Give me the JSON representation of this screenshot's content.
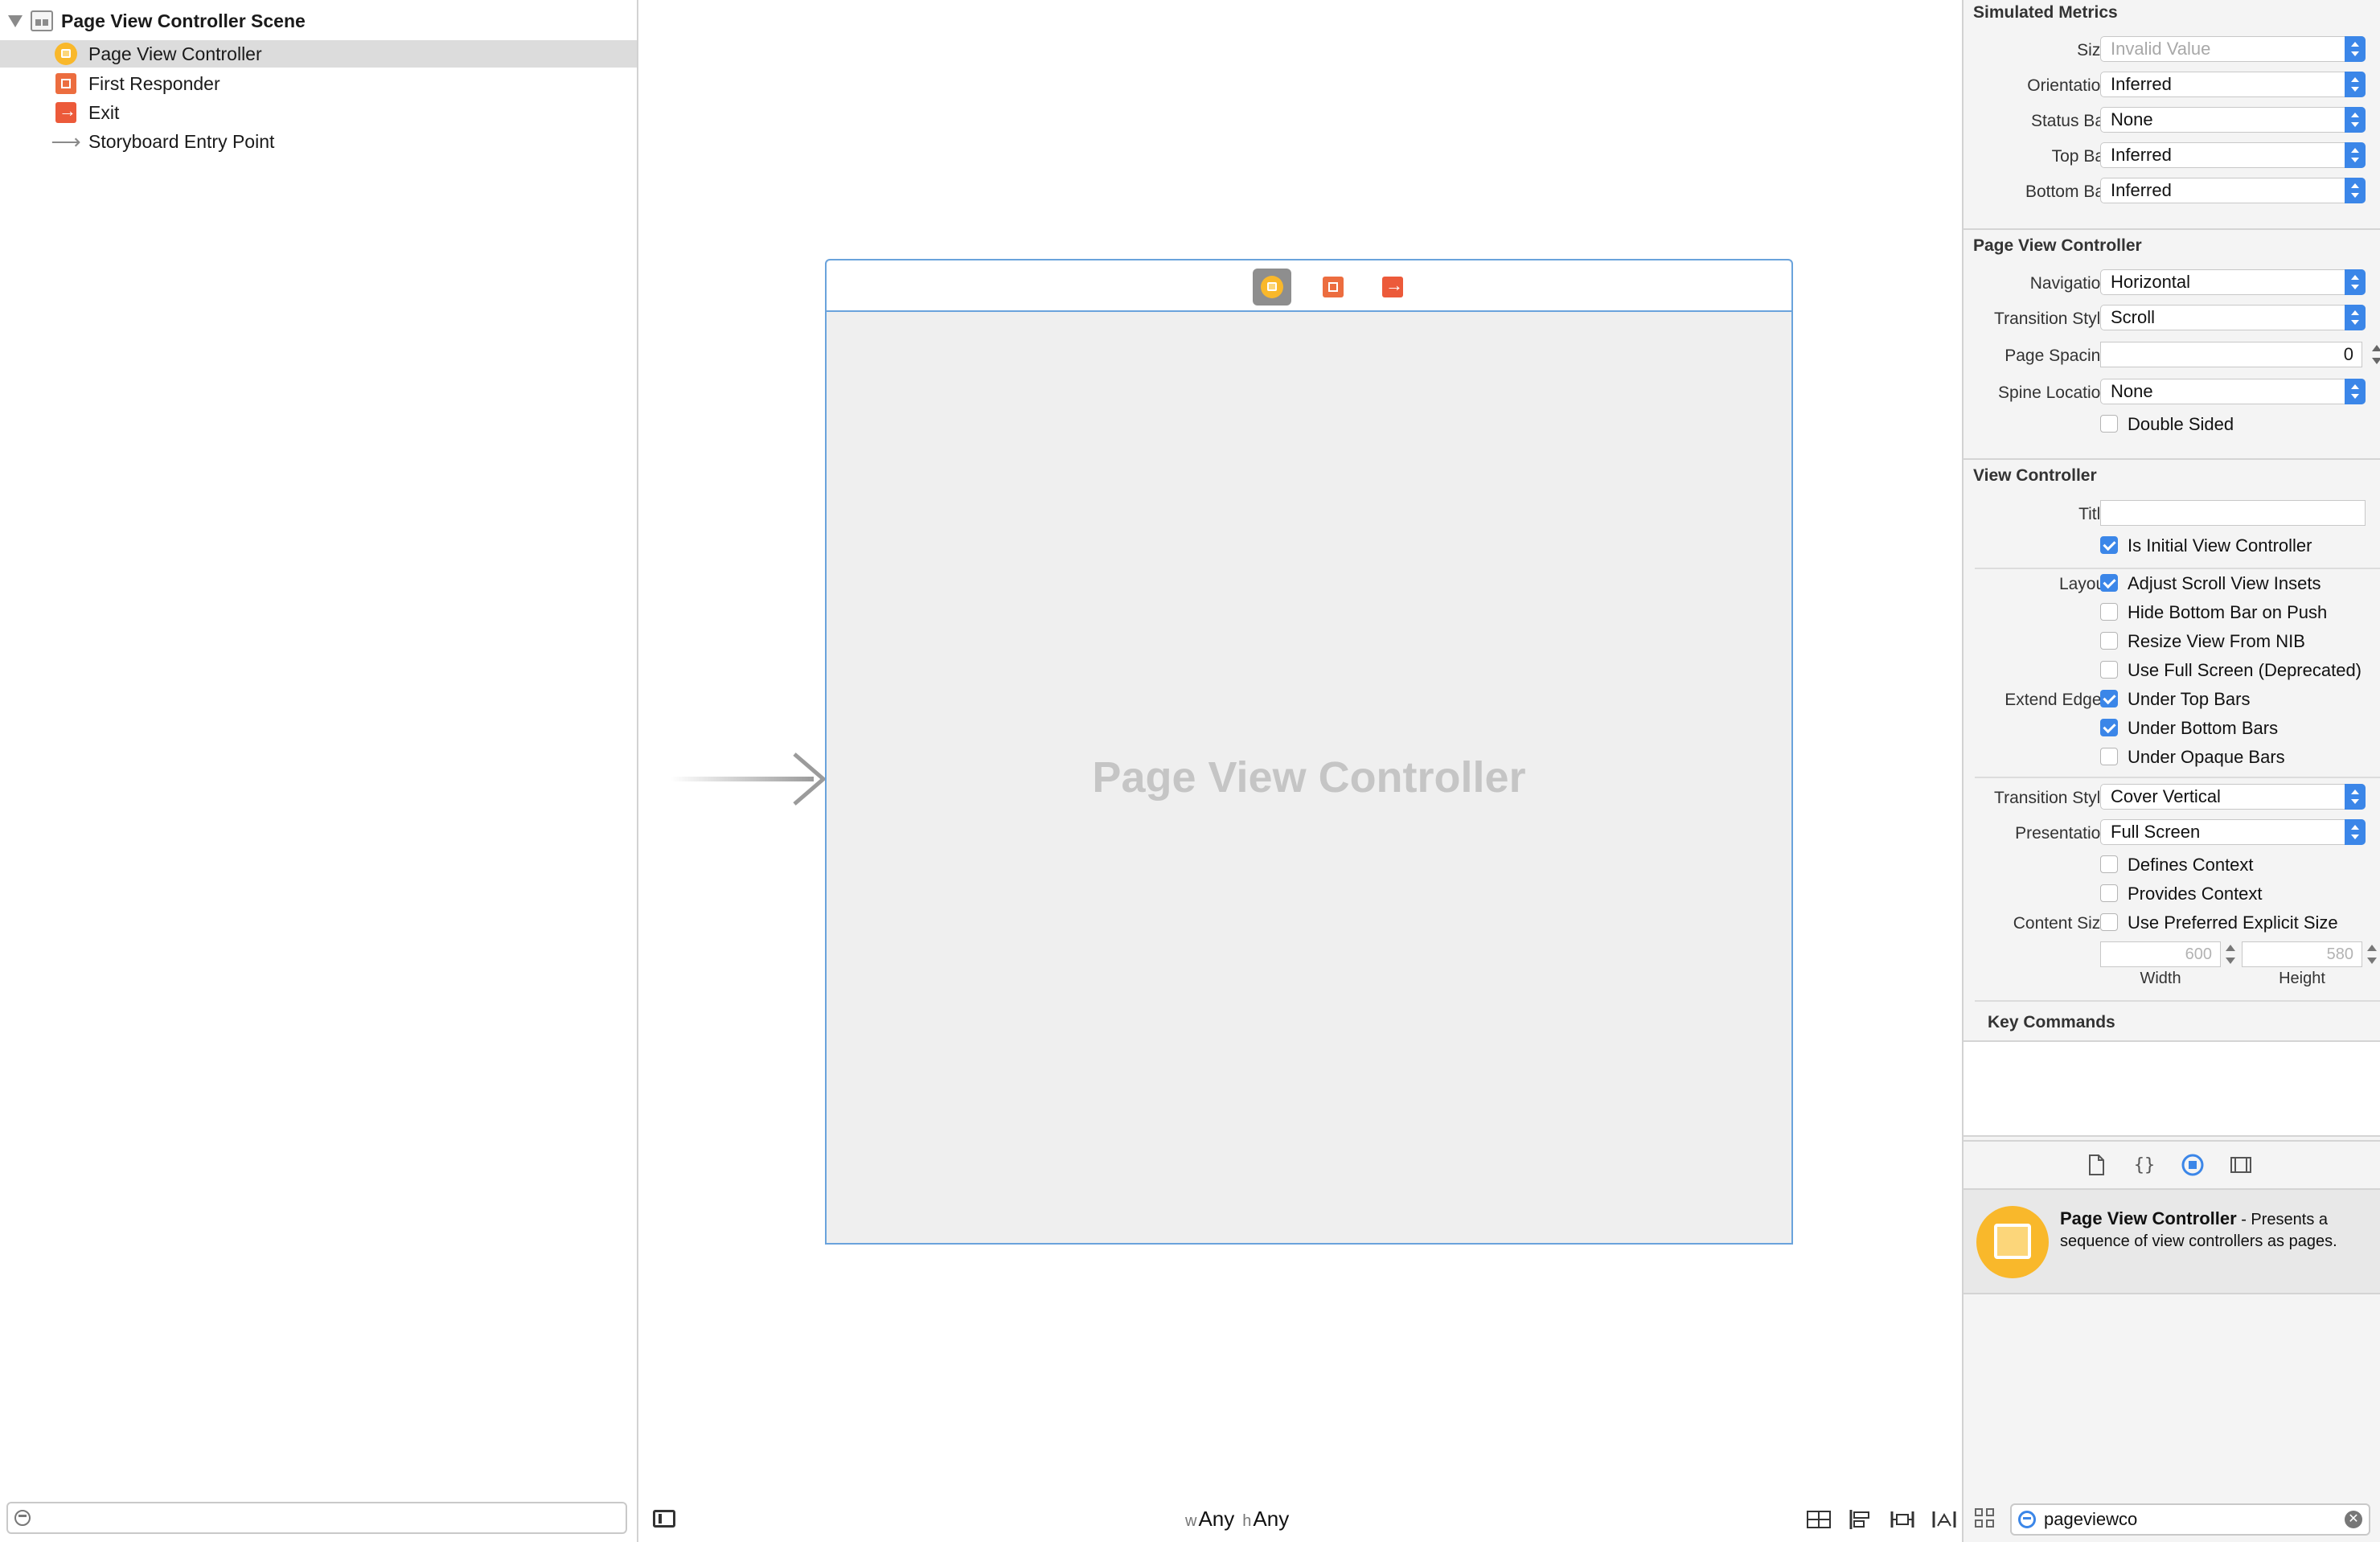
{
  "outline": {
    "scene_title": "Page View Controller Scene",
    "items": [
      {
        "label": "Page View Controller",
        "icon": "page-view-controller-icon",
        "selected": true
      },
      {
        "label": "First Responder",
        "icon": "first-responder-icon",
        "selected": false
      },
      {
        "label": "Exit",
        "icon": "exit-icon",
        "selected": false
      },
      {
        "label": "Storyboard Entry Point",
        "icon": "entry-arrow-icon",
        "selected": false
      }
    ],
    "filter_value": ""
  },
  "canvas": {
    "title": "Page View Controller",
    "size_class": {
      "w_prefix": "w",
      "w_value": "Any",
      "h_prefix": "h",
      "h_value": "Any"
    }
  },
  "inspector": {
    "simulated_metrics": {
      "header": "Simulated Metrics",
      "size_label": "Size",
      "size_value": "Invalid Value",
      "orientation_label": "Orientation",
      "orientation_value": "Inferred",
      "status_bar_label": "Status Bar",
      "status_bar_value": "None",
      "top_bar_label": "Top Bar",
      "top_bar_value": "Inferred",
      "bottom_bar_label": "Bottom Bar",
      "bottom_bar_value": "Inferred"
    },
    "page_view_controller": {
      "header": "Page View Controller",
      "navigation_label": "Navigation",
      "navigation_value": "Horizontal",
      "transition_style_label": "Transition Style",
      "transition_style_value": "Scroll",
      "page_spacing_label": "Page Spacing",
      "page_spacing_value": "0",
      "spine_location_label": "Spine Location",
      "spine_location_value": "None",
      "double_sided_label": "Double Sided",
      "double_sided_checked": false
    },
    "view_controller": {
      "header": "View Controller",
      "title_label": "Title",
      "title_value": "",
      "is_initial_label": "Is Initial View Controller",
      "is_initial_checked": true,
      "layout_label": "Layout",
      "adjust_insets_label": "Adjust Scroll View Insets",
      "adjust_insets_checked": true,
      "hide_bottom_bar_label": "Hide Bottom Bar on Push",
      "hide_bottom_bar_checked": false,
      "resize_nib_label": "Resize View From NIB",
      "resize_nib_checked": false,
      "full_screen_label": "Use Full Screen (Deprecated)",
      "full_screen_checked": false,
      "extend_edges_label": "Extend Edges",
      "under_top_label": "Under Top Bars",
      "under_top_checked": true,
      "under_bottom_label": "Under Bottom Bars",
      "under_bottom_checked": true,
      "under_opaque_label": "Under Opaque Bars",
      "under_opaque_checked": false,
      "transition_style_label": "Transition Style",
      "transition_style_value": "Cover Vertical",
      "presentation_label": "Presentation",
      "presentation_value": "Full Screen",
      "defines_context_label": "Defines Context",
      "defines_context_checked": false,
      "provides_context_label": "Provides Context",
      "provides_context_checked": false,
      "content_size_label": "Content Size",
      "preferred_size_label": "Use Preferred Explicit Size",
      "preferred_size_checked": false,
      "width_value": "600",
      "width_label": "Width",
      "height_value": "580",
      "height_label": "Height"
    },
    "key_commands": {
      "header": "Key Commands"
    }
  },
  "library": {
    "tabs": [
      "file-template-icon",
      "code-snippet-icon",
      "object-library-icon",
      "media-library-icon"
    ],
    "item_title": "Page View Controller",
    "item_desc": " - Presents a sequence of view controllers as pages.",
    "filter_value": "pageviewco"
  },
  "colors": {
    "accent": "#3b86e8",
    "selection_border": "#6aa3dc",
    "controller_icon": "#f9b82b",
    "responder_icon": "#ec6d3f"
  }
}
